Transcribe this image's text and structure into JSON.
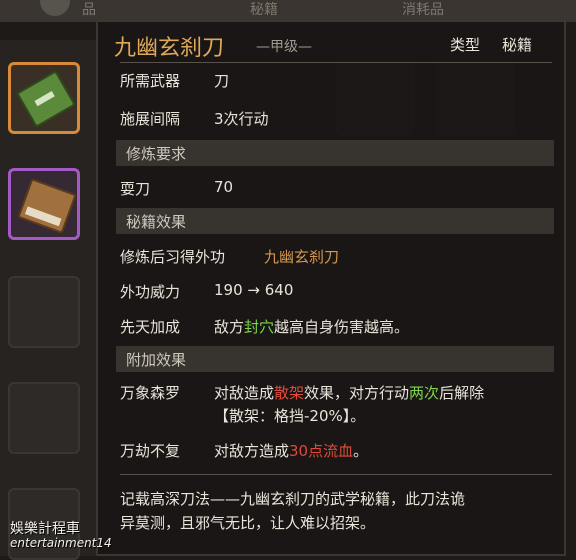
{
  "top_tabs": {
    "tab_items": "品",
    "tab_manual": "秘籍",
    "tab_consumables": "消耗品"
  },
  "item": {
    "name": "九幽玄刹刀",
    "grade": "—甲级—",
    "type_label": "类型",
    "type_value": "秘籍"
  },
  "info": {
    "weapon_label": "所需武器",
    "weapon_value": "刀",
    "interval_label": "施展间隔",
    "interval_value": "3次行动"
  },
  "requirements": {
    "header": "修炼要求",
    "skill_label": "耍刀",
    "skill_value": "70"
  },
  "effects": {
    "header": "秘籍效果",
    "learn_label": "修炼后习得外功",
    "learn_value": "九幽玄刹刀",
    "power_label": "外功威力",
    "power_value": "190 → 640",
    "innate_label": "先天加成",
    "innate_pre": "敌方",
    "innate_hl": "封穴",
    "innate_post": "越高自身伤害越高。"
  },
  "extra": {
    "header": "附加效果",
    "e1_label": "万象森罗",
    "e1_pre": "对敌造成",
    "e1_hl": "散架",
    "e1_mid": "效果，对方行动",
    "e1_hl2": "两次",
    "e1_post": "后解除",
    "e1_line2": "【散架：格挡-20%】。",
    "e2_label": "万劫不复",
    "e2_pre": "对敌方造成",
    "e2_hl": "30点流血",
    "e2_post": "。"
  },
  "description": {
    "line1": "记载高深刀法——九幽玄刹刀的武学秘籍，此刀法诡",
    "line2": "异莫测，且邪气无比，让人难以招架。"
  },
  "watermark": {
    "line1": "娛樂計程車",
    "line2": "entertainment14"
  },
  "colors": {
    "title": "#e0a95a",
    "highlight_orange": "#d8964f",
    "highlight_green": "#7bd64a",
    "highlight_red": "#e04a3a",
    "selected_slot_orange": "#d78a38",
    "selected_slot_purple": "#a55ac5"
  }
}
